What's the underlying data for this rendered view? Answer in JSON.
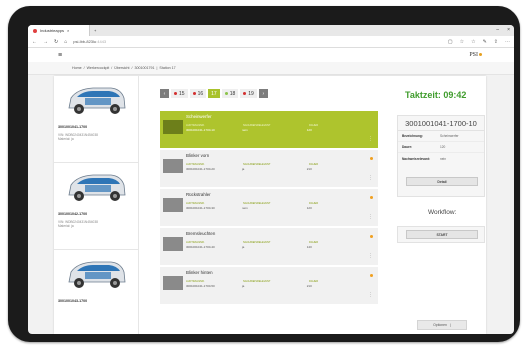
{
  "browser": {
    "tab_title": "Industrieapps",
    "url_main": "psi-lbb-823lu",
    "url_suffix": ":4443",
    "win_min": "–",
    "win_close": "×"
  },
  "app": {
    "logo": "PSI"
  },
  "breadcrumb": [
    "Home",
    "/",
    "Werkercockpit",
    "/",
    "Übersicht",
    "/",
    "3001001791",
    "|",
    "Station 17"
  ],
  "cars": [
    {
      "id": "3001001041-1700",
      "vin": "VIN: WDB0240431N454038",
      "material": "Material: ja"
    },
    {
      "id": "3001001042-1700",
      "vin": "VIN: WDB0240431N454038",
      "material": "Material: ja"
    },
    {
      "id": "3001001043-1700",
      "vin": "",
      "material": ""
    }
  ],
  "pager": {
    "prev": "‹",
    "next": "›",
    "pages": [
      {
        "n": "15",
        "dot": "red"
      },
      {
        "n": "16",
        "dot": "red"
      },
      {
        "n": "17",
        "dot": "none"
      },
      {
        "n": "18",
        "dot": "green"
      },
      {
        "n": "19",
        "dot": "red"
      }
    ],
    "active": "17"
  },
  "list_headers": {
    "c1": "AUFTRAGSNR.",
    "c2": "NACHWEISRELEVANT",
    "c3": "DAUER"
  },
  "items": [
    {
      "title": "Scheinwerfer",
      "order": "3001001041-1700-10",
      "nachweis": "nein",
      "dauer": "120",
      "selected": true
    },
    {
      "title": "Blinker vorn",
      "order": "3001001041-1700-20",
      "nachweis": "ja",
      "dauer": "210",
      "selected": false
    },
    {
      "title": "Rückstrahler",
      "order": "3001001041-1700-30",
      "nachweis": "nein",
      "dauer": "120",
      "selected": false
    },
    {
      "title": "Bremsleuchten",
      "order": "3001001041-1700-40",
      "nachweis": "ja",
      "dauer": "140",
      "selected": false
    },
    {
      "title": "Blinker hinten",
      "order": "3001001041-1700-50",
      "nachweis": "ja",
      "dauer": "210",
      "selected": false
    }
  ],
  "detail": {
    "takt_label": "Taktzeit: 09:42",
    "header": "3001001041-1700-10",
    "rows": [
      {
        "k": "Bezeichnung:",
        "v": "Scheinwerfer"
      },
      {
        "k": "Dauer:",
        "v": "120"
      },
      {
        "k": "Nachweisrelevant:",
        "v": "nein"
      }
    ],
    "detail_button": "Detail",
    "workflow_label": "Workflow:",
    "start_button": "START"
  },
  "options_label": "Optionen",
  "colors": {
    "accent": "#aec42d",
    "takt": "#3f9c2c",
    "status": "#f0a020",
    "alert": "#d32f2f"
  }
}
